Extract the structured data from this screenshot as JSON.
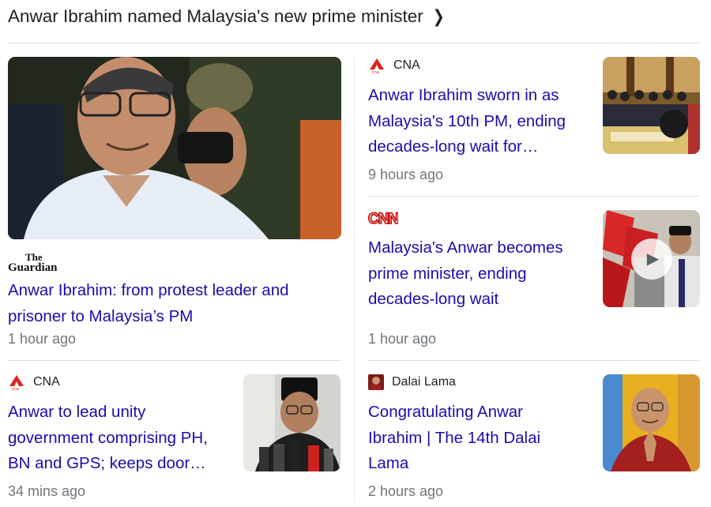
{
  "header": {
    "title": "Anwar Ibrahim named Malaysia's new prime minister",
    "chevron_icon": "chevron-right-icon"
  },
  "colors": {
    "link": "#1a0dab",
    "meta": "#70757a",
    "cna": "#e2231a",
    "cnn": "#cc0000"
  },
  "stories": [
    {
      "source": "The Guardian",
      "source_logo": "The\nGuardian",
      "title_lines": [
        "Anwar Ibrahim: from protest leader and",
        "prisoner to Malaysia’s PM"
      ],
      "time": "1 hour ago"
    },
    {
      "source": "CNA",
      "title_lines": [
        "Anwar Ibrahim sworn in as",
        "Malaysia's 10th PM, ending",
        "decades-long wait for…"
      ],
      "time": "9 hours ago"
    },
    {
      "source": "CNN",
      "source_logo": "CNN",
      "title_lines": [
        "Malaysia's Anwar becomes",
        "prime minister, ending",
        "decades-long wait"
      ],
      "time": "1 hour ago",
      "has_video": true
    },
    {
      "source": "CNA",
      "title_lines": [
        "Anwar to lead unity",
        "government comprising PH,",
        "BN and GPS; keeps door…"
      ],
      "time": "34 mins ago"
    },
    {
      "source": "Dalai Lama",
      "title_lines": [
        "Congratulating Anwar",
        "Ibrahim | The 14th Dalai",
        "Lama"
      ],
      "time": "2 hours ago"
    }
  ]
}
